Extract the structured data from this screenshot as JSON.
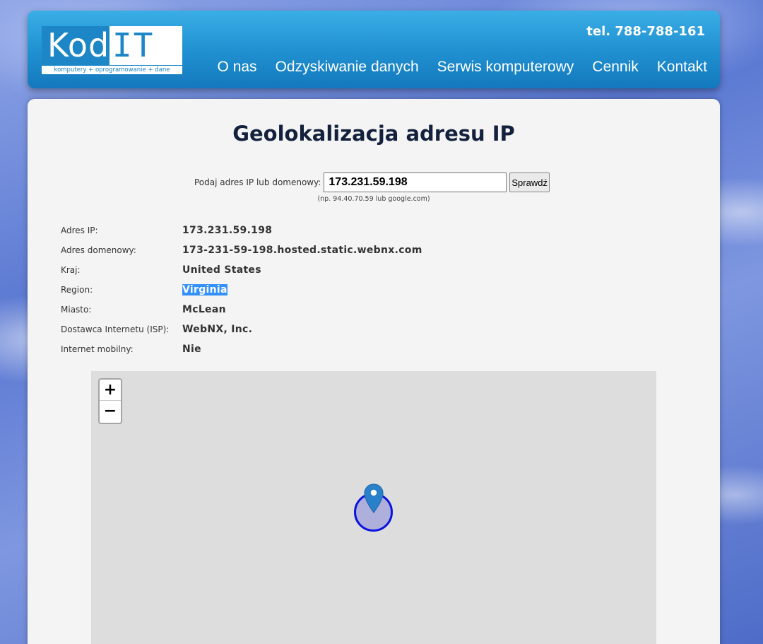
{
  "header": {
    "logo_kod": "Kod",
    "logo_it": "IT",
    "logo_tagline": "komputery + oprogramowanie + dane",
    "phone": "tel. 788-788-161",
    "nav": [
      {
        "label": "O nas"
      },
      {
        "label": "Odzyskiwanie danych"
      },
      {
        "label": "Serwis komputerowy"
      },
      {
        "label": "Cennik"
      },
      {
        "label": "Kontakt"
      }
    ]
  },
  "main": {
    "title": "Geolokalizacja adresu IP",
    "form": {
      "label": "Podaj adres IP lub domenowy:",
      "value": "173.231.59.198",
      "button": "Sprawdź",
      "hint": "(np. 94.40.70.59 lub google.com)"
    },
    "info": [
      {
        "label": "Adres IP:",
        "value": "173.231.59.198"
      },
      {
        "label": "Adres domenowy:",
        "value": "173-231-59-198.hosted.static.webnx.com"
      },
      {
        "label": "Kraj:",
        "value": "United States"
      },
      {
        "label": "Region:",
        "value": "Virginia"
      },
      {
        "label": "Miasto:",
        "value": "McLean"
      },
      {
        "label": "Dostawca Internetu (ISP):",
        "value": "WebNX, Inc."
      },
      {
        "label": "Internet mobilny:",
        "value": "Nie"
      }
    ],
    "map": {
      "zoom_in": "+",
      "zoom_out": "−",
      "marker_color": "#2a81cb",
      "circle_color": "#0a12e0"
    }
  }
}
